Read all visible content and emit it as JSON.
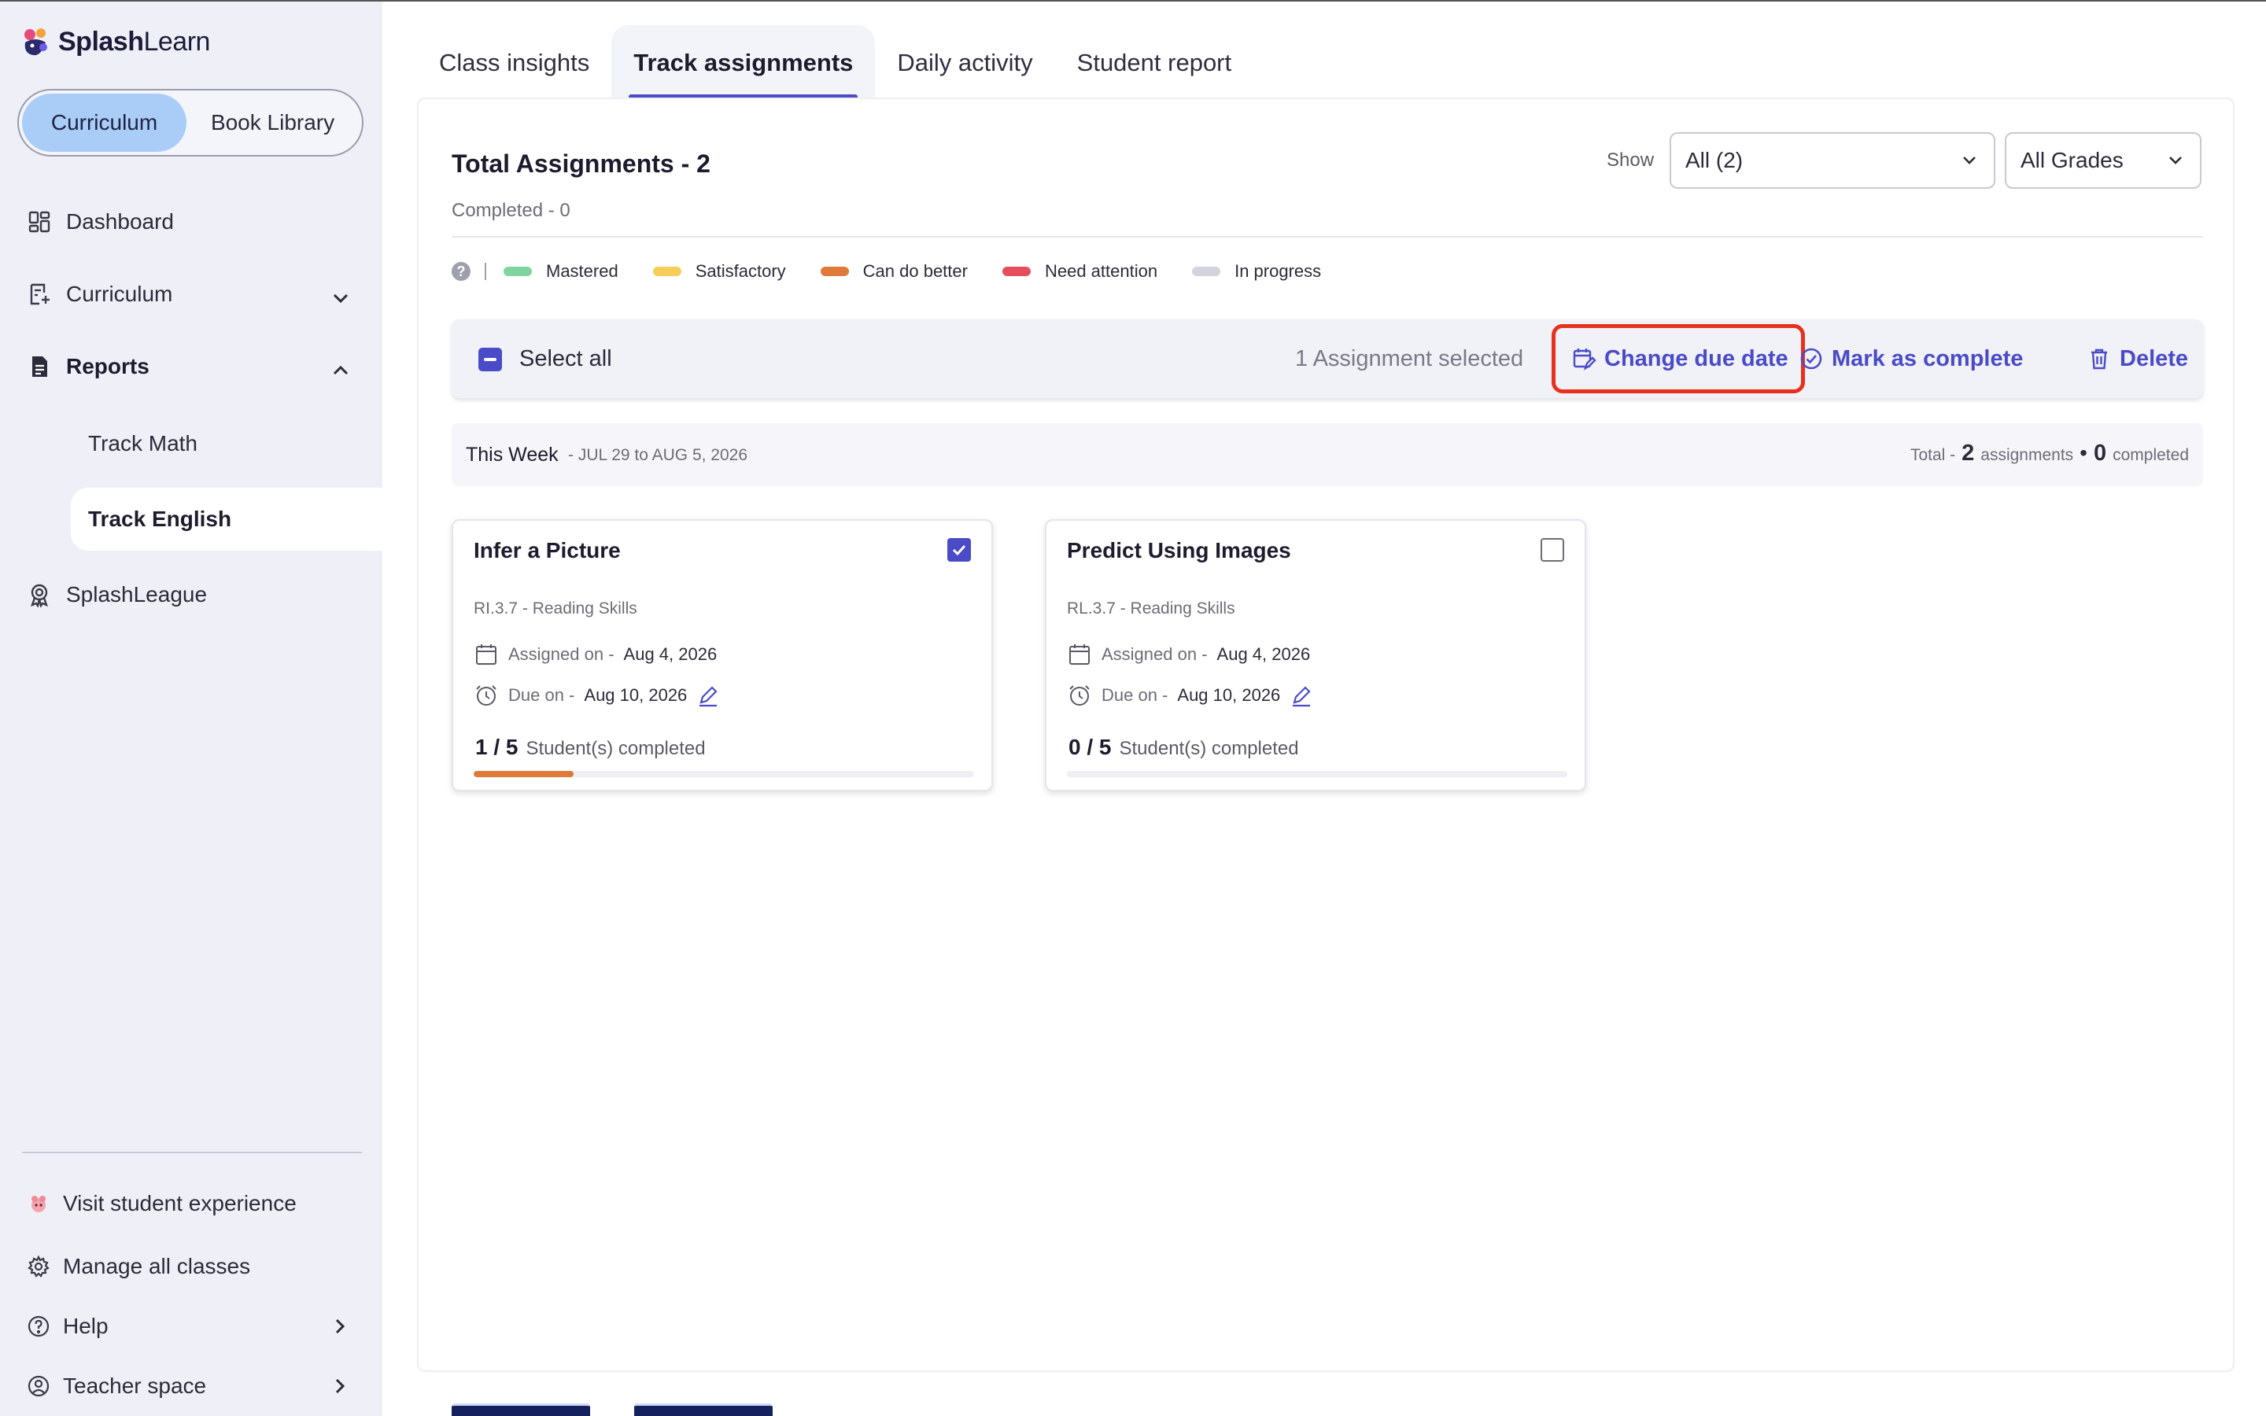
{
  "app": {
    "logo_text_bold": "Splash",
    "logo_text_light": "Learn"
  },
  "sidebar": {
    "segment": {
      "active": "Curriculum",
      "inactive": "Book Library"
    },
    "items": [
      {
        "label": "Dashboard",
        "icon": "dashboard-icon"
      },
      {
        "label": "Curriculum",
        "icon": "curriculum-icon"
      },
      {
        "label": "Reports",
        "icon": "reports-icon"
      },
      {
        "label": "SplashLeague",
        "icon": "splashleague-icon"
      }
    ],
    "sub_items": [
      {
        "label": "Track Math"
      },
      {
        "label": "Track English"
      }
    ],
    "footer": [
      {
        "label": "Visit student experience",
        "icon": "student-experience-icon"
      },
      {
        "label": "Manage all classes",
        "icon": "gear-icon"
      },
      {
        "label": "Help",
        "icon": "help-icon"
      },
      {
        "label": "Teacher space",
        "icon": "teacher-icon"
      }
    ]
  },
  "tabs": [
    {
      "label": "Class insights"
    },
    {
      "label": "Track assignments"
    },
    {
      "label": "Daily activity"
    },
    {
      "label": "Student report"
    }
  ],
  "header": {
    "title": "Total Assignments - 2",
    "completed": "Completed - 0",
    "show_label": "Show",
    "filter_status": "All (2)",
    "filter_grades": "All Grades"
  },
  "legend": {
    "help": "?",
    "items": [
      {
        "label": "Mastered",
        "color": "#7fd4a0"
      },
      {
        "label": "Satisfactory",
        "color": "#f6cd56"
      },
      {
        "label": "Can do better",
        "color": "#e07a3a"
      },
      {
        "label": "Need attention",
        "color": "#e44e5f"
      },
      {
        "label": "In progress",
        "color": "#d3d3dd"
      }
    ]
  },
  "action_bar": {
    "select_all": "Select all",
    "selected_count": "1 Assignment selected",
    "change_due_date": "Change due date",
    "mark_complete": "Mark as complete",
    "delete": "Delete",
    "accent_color": "#4a4bc7",
    "highlight_color": "#e8311d"
  },
  "week": {
    "label": "This Week",
    "range": "- JUL 29 to AUG 5, 2026",
    "total_prefix": "Total -",
    "total_count": "2",
    "total_suffix": "assignments",
    "dot": "•",
    "completed_count": "0",
    "completed_suffix": "completed"
  },
  "cards": [
    {
      "title": "Infer a Picture",
      "standard": "RI.3.7 - Reading Skills",
      "assigned_label": "Assigned on -",
      "assigned_date": "Aug 4, 2026",
      "due_label": "Due on -",
      "due_date": "Aug 10, 2026",
      "progress_text": "1 / 5",
      "progress_suffix": "Student(s) completed",
      "progress_fraction": 0.2,
      "checked": true
    },
    {
      "title": "Predict Using Images",
      "standard": "RL.3.7 - Reading Skills",
      "assigned_label": "Assigned on -",
      "assigned_date": "Aug 4, 2026",
      "due_label": "Due on -",
      "due_date": "Aug 10, 2026",
      "progress_text": "0 / 5",
      "progress_suffix": "Student(s) completed",
      "progress_fraction": 0.0,
      "checked": false
    }
  ]
}
